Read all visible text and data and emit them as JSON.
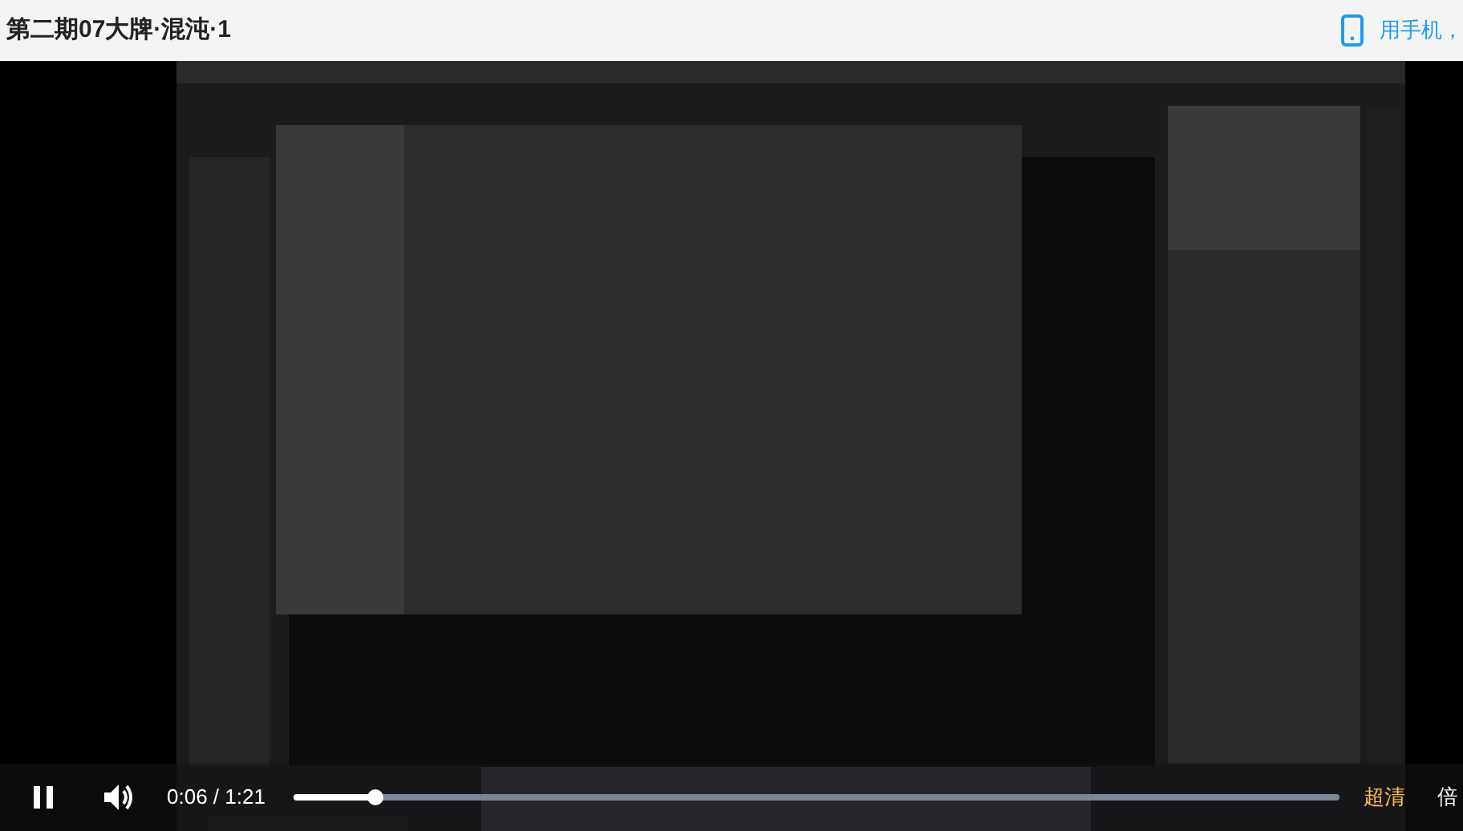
{
  "header": {
    "title": "第二期07大牌·混沌·1",
    "mobile_link": "用手机，"
  },
  "controls": {
    "playing": true,
    "time": "0:06 / 1:21",
    "progress": {
      "level": 0.078
    },
    "quality": "超清",
    "speed": "倍"
  }
}
